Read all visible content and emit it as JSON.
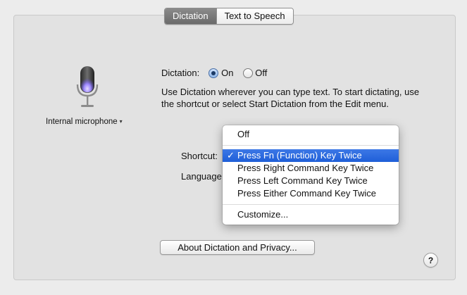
{
  "tabs": [
    {
      "label": "Dictation",
      "selected": true
    },
    {
      "label": "Text to Speech",
      "selected": false
    }
  ],
  "microphone": {
    "icon": "microphone-icon",
    "source_label": "Internal microphone",
    "dropdown_icon": "▾"
  },
  "dictation": {
    "label": "Dictation:",
    "on_label": "On",
    "off_label": "Off",
    "selected": "On",
    "description": "Use Dictation wherever you can type text. To start dictating, use the shortcut or select Start Dictation from the Edit menu."
  },
  "shortcut": {
    "label": "Shortcut:",
    "menu": {
      "items": [
        {
          "label": "Off"
        },
        {
          "label": "Press Fn (Function) Key Twice",
          "selected": true,
          "checkmark": "✓"
        },
        {
          "label": "Press Right Command Key Twice"
        },
        {
          "label": "Press Left Command Key Twice"
        },
        {
          "label": "Press Either Command Key Twice"
        },
        {
          "label": "Customize..."
        }
      ]
    }
  },
  "language": {
    "label": "Language:"
  },
  "buttons": {
    "about": "About Dictation and Privacy...",
    "help": "?"
  },
  "colors": {
    "accent": "#2a67dc",
    "panel": "#e2e2e2",
    "mic_glow": "#9b86ff"
  }
}
